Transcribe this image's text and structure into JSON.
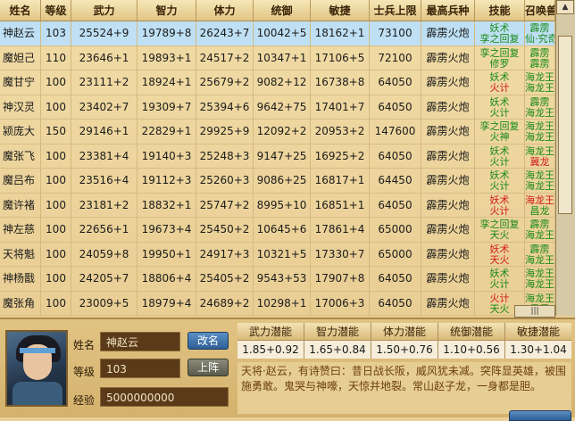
{
  "columns": [
    "姓名",
    "等级",
    "武力",
    "智力",
    "体力",
    "统御",
    "敏捷",
    "士兵上限",
    "最高兵种",
    "技能",
    "召唤兽"
  ],
  "rows": [
    {
      "name": "神赵云",
      "level": "103",
      "wu": "25524+9",
      "zhi": "19789+8",
      "ti": "26243+7",
      "tong": "10042+5",
      "min": "18162+1",
      "cap": "73100",
      "troop": "霹雳火炮",
      "skill1": "妖术",
      "skill1_color": "green",
      "skill2": "孪之回复",
      "skill2_color": "green",
      "beast1": "霹雳",
      "beast1_color": "green",
      "beast2": "仙·究奇",
      "beast2_color": "green",
      "selected": true
    },
    {
      "name": "魔妲己",
      "level": "110",
      "wu": "23646+1",
      "zhi": "19893+1",
      "ti": "24517+2",
      "tong": "10347+1",
      "min": "17106+5",
      "cap": "72100",
      "troop": "霹雳火炮",
      "skill1": "孪之回复",
      "skill1_color": "green",
      "skill2": "修罗",
      "skill2_color": "green",
      "beast1": "霹雳",
      "beast1_color": "green",
      "beast2": "霹雳",
      "beast2_color": "green"
    },
    {
      "name": "魔甘宁",
      "level": "100",
      "wu": "23111+2",
      "zhi": "18924+1",
      "ti": "25679+2",
      "tong": "9082+12",
      "min": "16738+8",
      "cap": "64050",
      "troop": "霹雳火炮",
      "skill1": "妖术",
      "skill1_color": "green",
      "skill2": "火计",
      "skill2_color": "red",
      "beast1": "海龙王",
      "beast1_color": "green",
      "beast2": "海龙王",
      "beast2_color": "green"
    },
    {
      "name": "神汉灵",
      "level": "100",
      "wu": "23402+7",
      "zhi": "19309+7",
      "ti": "25394+6",
      "tong": "9642+75",
      "min": "17401+7",
      "cap": "64050",
      "troop": "霹雳火炮",
      "skill1": "妖术",
      "skill1_color": "green",
      "skill2": "火计",
      "skill2_color": "green",
      "beast1": "霹雳",
      "beast1_color": "green",
      "beast2": "海龙王",
      "beast2_color": "green"
    },
    {
      "name": "颍庞大",
      "level": "150",
      "wu": "29146+1",
      "zhi": "22829+1",
      "ti": "29925+9",
      "tong": "12092+2",
      "min": "20953+2",
      "cap": "147600",
      "troop": "霹雳火炮",
      "skill1": "孪之回复",
      "skill1_color": "green",
      "skill2": "火神",
      "skill2_color": "green",
      "beast1": "海龙王",
      "beast1_color": "green",
      "beast2": "海龙王",
      "beast2_color": "green"
    },
    {
      "name": "魔张飞",
      "level": "100",
      "wu": "23381+4",
      "zhi": "19140+3",
      "ti": "25248+3",
      "tong": "9147+25",
      "min": "16925+2",
      "cap": "64050",
      "troop": "霹雳火炮",
      "skill1": "妖术",
      "skill1_color": "green",
      "skill2": "火计",
      "skill2_color": "green",
      "beast1": "海龙王",
      "beast1_color": "green",
      "beast2": "冀龙",
      "beast2_color": "red"
    },
    {
      "name": "魔吕布",
      "level": "100",
      "wu": "23516+4",
      "zhi": "19112+3",
      "ti": "25260+3",
      "tong": "9086+25",
      "min": "16817+1",
      "cap": "64450",
      "troop": "霹雳火炮",
      "skill1": "妖术",
      "skill1_color": "green",
      "skill2": "火计",
      "skill2_color": "green",
      "beast1": "海龙王",
      "beast1_color": "green",
      "beast2": "海龙王",
      "beast2_color": "green"
    },
    {
      "name": "魔许褚",
      "level": "100",
      "wu": "23181+2",
      "zhi": "18832+1",
      "ti": "25747+2",
      "tong": "8995+10",
      "min": "16851+1",
      "cap": "64050",
      "troop": "霹雳火炮",
      "skill1": "妖术",
      "skill1_color": "red",
      "skill2": "火计",
      "skill2_color": "red",
      "beast1": "海龙王",
      "beast1_color": "red",
      "beast2": "昌龙",
      "beast2_color": "green"
    },
    {
      "name": "神左慈",
      "level": "100",
      "wu": "22656+1",
      "zhi": "19673+4",
      "ti": "25450+2",
      "tong": "10645+6",
      "min": "17861+4",
      "cap": "65000",
      "troop": "霹雳火炮",
      "skill1": "孪之回复",
      "skill1_color": "green",
      "skill2": "天火",
      "skill2_color": "green",
      "beast1": "霹雳",
      "beast1_color": "green",
      "beast2": "海龙王",
      "beast2_color": "green"
    },
    {
      "name": "天将魁",
      "level": "100",
      "wu": "24059+8",
      "zhi": "19950+1",
      "ti": "24917+3",
      "tong": "10321+5",
      "min": "17330+7",
      "cap": "65000",
      "troop": "霹雳火炮",
      "skill1": "妖术",
      "skill1_color": "red",
      "skill2": "天火",
      "skill2_color": "red",
      "beast1": "霹雳",
      "beast1_color": "green",
      "beast2": "海龙王",
      "beast2_color": "green"
    },
    {
      "name": "神杨戬",
      "level": "100",
      "wu": "24205+7",
      "zhi": "18806+4",
      "ti": "25405+2",
      "tong": "9543+53",
      "min": "17907+8",
      "cap": "64050",
      "troop": "霹雳火炮",
      "skill1": "妖术",
      "skill1_color": "green",
      "skill2": "火计",
      "skill2_color": "green",
      "beast1": "海龙王",
      "beast1_color": "green",
      "beast2": "海龙王",
      "beast2_color": "green"
    },
    {
      "name": "魔张角",
      "level": "100",
      "wu": "23009+5",
      "zhi": "18979+4",
      "ti": "24689+2",
      "tong": "10298+1",
      "min": "17006+3",
      "cap": "64050",
      "troop": "霹雳火炮",
      "skill1": "火计",
      "skill1_color": "red",
      "skill2": "天火",
      "skill2_color": "green",
      "beast1": "海龙王",
      "beast1_color": "green",
      "beast2": "霹雳",
      "beast2_color": "green"
    }
  ],
  "detail": {
    "name_label": "姓名",
    "name_value": "神赵云",
    "level_label": "等级",
    "level_value": "103",
    "exp_label": "经验",
    "exp_value": "5000000000",
    "rename_button": "改名",
    "deploy_button": "上阵"
  },
  "potential": [
    {
      "label": "武力潜能",
      "value": "1.85+0.92"
    },
    {
      "label": "智力潜能",
      "value": "1.65+0.84"
    },
    {
      "label": "体力潜能",
      "value": "1.50+0.76"
    },
    {
      "label": "统御潜能",
      "value": "1.10+0.56"
    },
    {
      "label": "敏捷潜能",
      "value": "1.30+1.04"
    }
  ],
  "description": "天将·赵云，有诗赞曰：昔日战长阪，威风犹未减。突阵显英雄，被围施勇敢。鬼哭与神嚎，天惊并地裂。常山赵子龙，一身都是胆。",
  "colors": {
    "green": "#178a17",
    "red": "#d11a1a",
    "selected_row": "#bfe0f4",
    "header_bg": "#e2c585"
  }
}
